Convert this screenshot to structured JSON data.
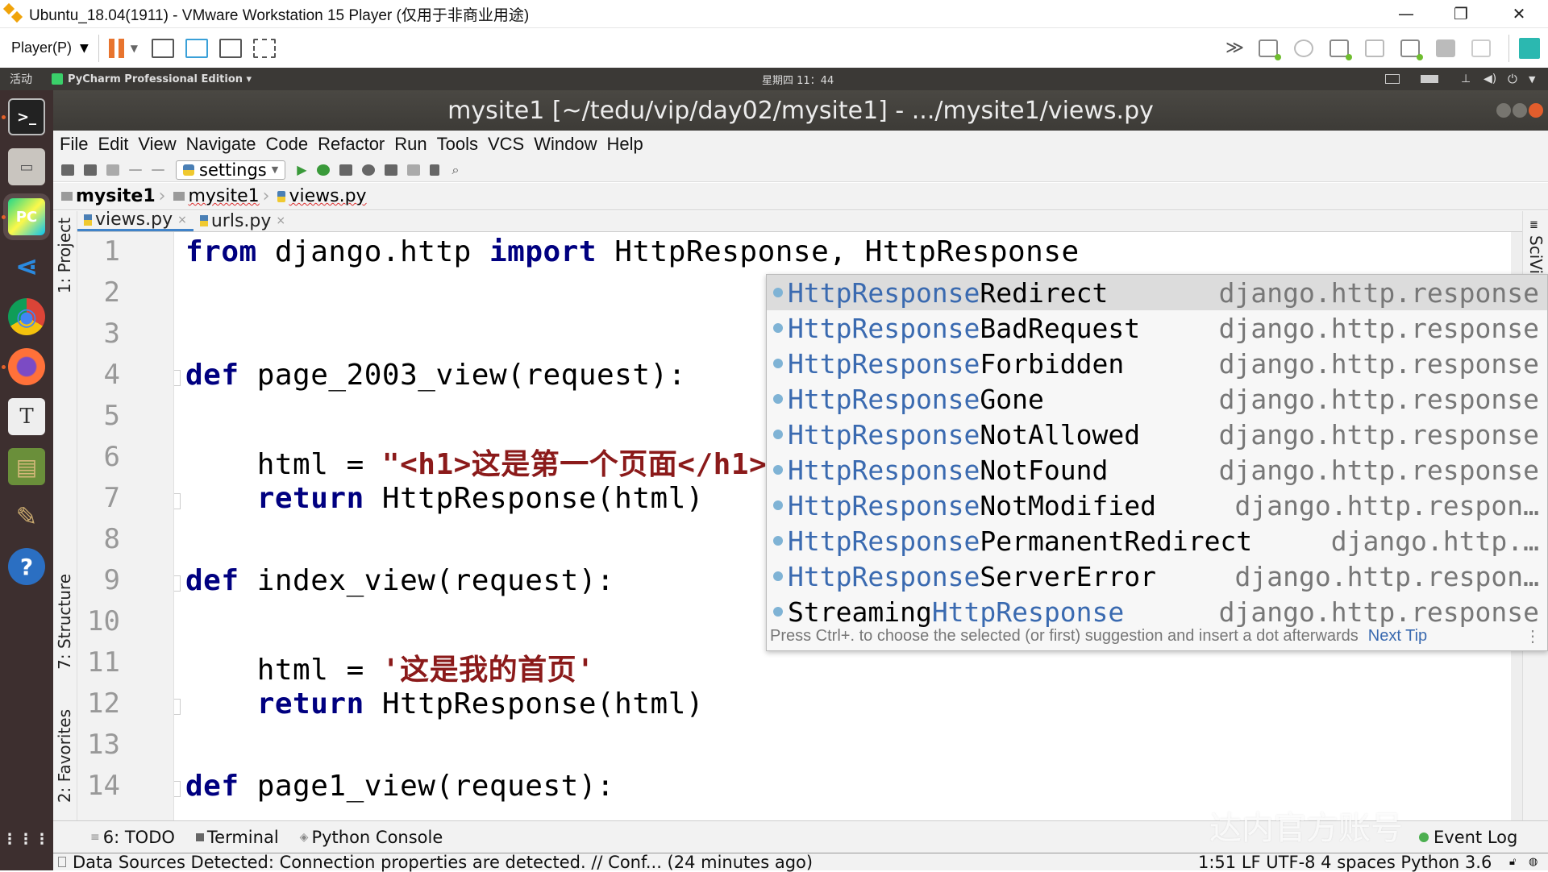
{
  "vm_window": {
    "title": "Ubuntu_18.04(1911) - VMware Workstation 15 Player (仅用于非商业用途)",
    "player_menu": "Player(P)",
    "controls": {
      "minimize": "—",
      "restore": "❐",
      "close": "✕"
    }
  },
  "ubuntu_topbar": {
    "activities": "活动",
    "app_menu": "PyCharm Professional Edition ▾",
    "clock": "星期四 11：44"
  },
  "dock": {
    "items": [
      {
        "name": "terminal",
        "label": ">_",
        "running": true
      },
      {
        "name": "files",
        "label": "▭",
        "running": false
      },
      {
        "name": "pycharm",
        "label": "PC",
        "running": true,
        "active": true
      },
      {
        "name": "vscode",
        "label": "⋖",
        "running": false
      },
      {
        "name": "chrome",
        "label": "◉",
        "running": false
      },
      {
        "name": "firefox",
        "label": "◕",
        "running": true
      },
      {
        "name": "typora",
        "label": "T",
        "running": false
      },
      {
        "name": "books",
        "label": "▤",
        "running": false
      },
      {
        "name": "paint",
        "label": "✎",
        "running": false
      },
      {
        "name": "help",
        "label": "?",
        "running": false
      }
    ],
    "apps_grid": "⋮⋮⋮"
  },
  "pycharm": {
    "window_title": "mysite1 [~/tedu/vip/day02/mysite1] - .../mysite1/views.py",
    "menu": [
      "File",
      "Edit",
      "View",
      "Navigate",
      "Code",
      "Refactor",
      "Run",
      "Tools",
      "VCS",
      "Window",
      "Help"
    ],
    "run_config": "settings",
    "breadcrumb": [
      "mysite1",
      "mysite1",
      "views.py"
    ],
    "tabs": [
      {
        "label": "views.py",
        "active": true
      },
      {
        "label": "urls.py",
        "active": false
      }
    ],
    "left_tools": [
      "1: Project",
      "7: Structure",
      "2: Favorites"
    ],
    "right_tools": [
      "SciView"
    ],
    "code_lines": [
      {
        "n": "1",
        "tokens": [
          [
            "kw",
            "from"
          ],
          [
            "",
            "django.http "
          ],
          [
            "kw",
            "import"
          ],
          [
            "",
            "HttpResponse, HttpResponse"
          ]
        ]
      },
      {
        "n": "2",
        "tokens": []
      },
      {
        "n": "3",
        "tokens": []
      },
      {
        "n": "4",
        "tokens": [
          [
            "kw",
            "def"
          ],
          [
            "",
            "page_2003_view(request):"
          ]
        ]
      },
      {
        "n": "5",
        "tokens": []
      },
      {
        "n": "6",
        "tokens": [
          [
            "",
            "    html = "
          ],
          [
            "str",
            "\"<h1>这是第一个页面</h1>\""
          ]
        ]
      },
      {
        "n": "7",
        "tokens": [
          [
            "",
            "    "
          ],
          [
            "kw",
            "return"
          ],
          [
            "",
            "HttpResponse(html)"
          ]
        ]
      },
      {
        "n": "8",
        "tokens": []
      },
      {
        "n": "9",
        "tokens": [
          [
            "kw",
            "def"
          ],
          [
            "",
            "index_view(request):"
          ]
        ]
      },
      {
        "n": "10",
        "tokens": []
      },
      {
        "n": "11",
        "tokens": [
          [
            "",
            "    html = "
          ],
          [
            "str",
            "'这是我的首页'"
          ]
        ]
      },
      {
        "n": "12",
        "tokens": [
          [
            "",
            "    "
          ],
          [
            "kw",
            "return"
          ],
          [
            "",
            "HttpResponse(html)"
          ]
        ]
      },
      {
        "n": "13",
        "tokens": []
      },
      {
        "n": "14",
        "tokens": [
          [
            "kw",
            "def"
          ],
          [
            "",
            "page1_view(request):"
          ]
        ]
      }
    ],
    "completion": {
      "items": [
        {
          "prefix": "",
          "match": "HttpResponse",
          "suffix": "Redirect",
          "location": "django.http.response",
          "selected": true
        },
        {
          "prefix": "",
          "match": "HttpResponse",
          "suffix": "BadRequest",
          "location": "django.http.response"
        },
        {
          "prefix": "",
          "match": "HttpResponse",
          "suffix": "Forbidden",
          "location": "django.http.response"
        },
        {
          "prefix": "",
          "match": "HttpResponse",
          "suffix": "Gone",
          "location": "django.http.response"
        },
        {
          "prefix": "",
          "match": "HttpResponse",
          "suffix": "NotAllowed",
          "location": "django.http.response"
        },
        {
          "prefix": "",
          "match": "HttpResponse",
          "suffix": "NotFound",
          "location": "django.http.response"
        },
        {
          "prefix": "",
          "match": "HttpResponse",
          "suffix": "NotModified",
          "location": "django.http.respon…"
        },
        {
          "prefix": "",
          "match": "HttpResponse",
          "suffix": "PermanentRedirect",
          "location": "django.http.…"
        },
        {
          "prefix": "",
          "match": "HttpResponse",
          "suffix": "ServerError",
          "location": "django.http.respon…"
        },
        {
          "prefix": "Streaming",
          "match": "HttpResponse",
          "suffix": "",
          "location": "django.http.response"
        }
      ],
      "hint": "Press Ctrl+. to choose the selected (or first) suggestion and insert a dot afterwards",
      "next_tip": "Next Tip"
    },
    "bottom_tools": [
      "6: TODO",
      "Terminal",
      "Python Console"
    ],
    "event_log": "Event Log",
    "status_message": "Data Sources Detected: Connection properties are detected. // Conf... (24 minutes ago)",
    "status_right": "1:51  LF  UTF-8  4 spaces  Python 3.6"
  },
  "watermark": "达内官方账号"
}
